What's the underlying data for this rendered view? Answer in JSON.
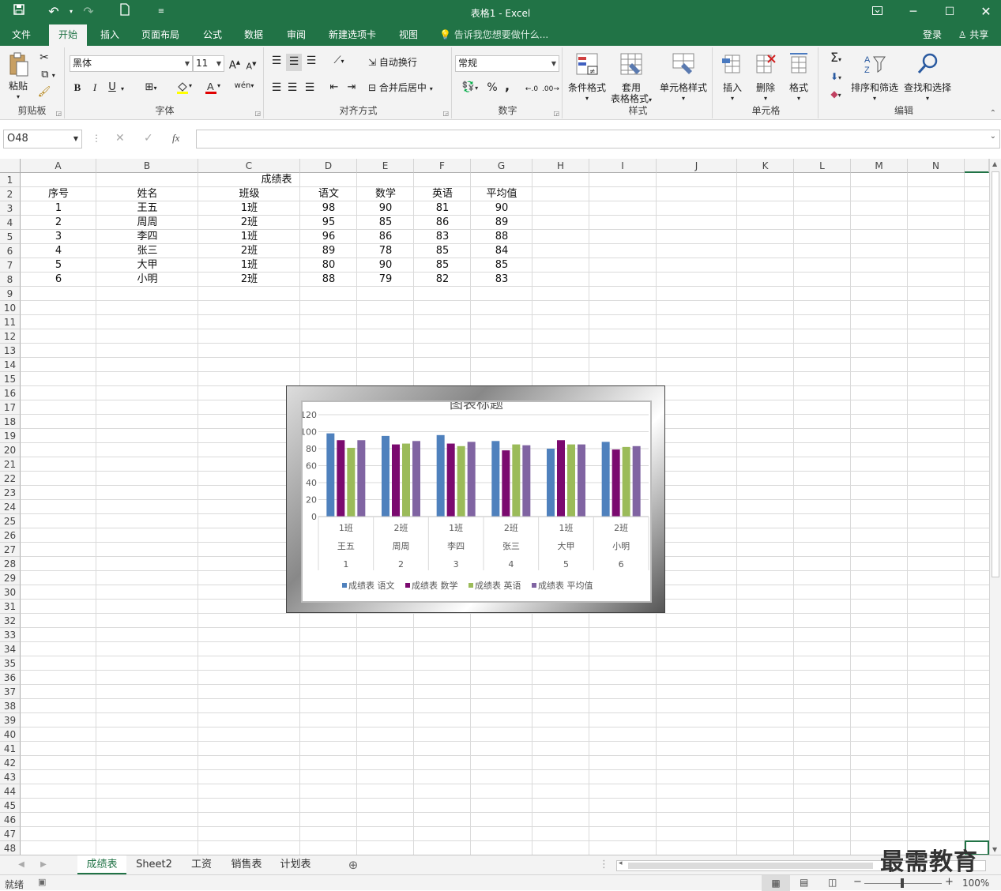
{
  "window": {
    "title": "表格1 - Excel"
  },
  "tabs": [
    "文件",
    "开始",
    "插入",
    "页面布局",
    "公式",
    "数据",
    "审阅",
    "新建选项卡",
    "视图"
  ],
  "active_tab": "开始",
  "tell_me": "告诉我您想要做什么...",
  "account": {
    "login": "登录",
    "share": "共享"
  },
  "ribbon": {
    "clipboard": {
      "label": "剪贴板",
      "paste": "粘贴"
    },
    "font": {
      "label": "字体",
      "name": "黑体",
      "size": "11",
      "bold": "B",
      "italic": "I",
      "underline": "U",
      "phonetic": "wén"
    },
    "alignment": {
      "label": "对齐方式",
      "wrap": "自动换行",
      "merge": "合并后居中"
    },
    "number": {
      "label": "数字",
      "format": "常规",
      "percent": "%",
      "comma": ","
    },
    "styles": {
      "label": "样式",
      "conditional": "条件格式",
      "table1": "套用",
      "table2": "表格格式",
      "cell_styles": "单元格样式"
    },
    "cells": {
      "label": "单元格",
      "insert": "插入",
      "delete": "删除",
      "format": "格式"
    },
    "editing": {
      "label": "编辑",
      "sort": "排序和筛选",
      "find": "查找和选择"
    }
  },
  "formula_bar": {
    "name_box": "O48",
    "fx": "fx",
    "value": ""
  },
  "columns": [
    "A",
    "B",
    "C",
    "D",
    "E",
    "F",
    "G",
    "H",
    "I",
    "J",
    "K",
    "L",
    "M",
    "N"
  ],
  "rows": [
    "1",
    "2",
    "3",
    "4",
    "5",
    "6",
    "7",
    "8",
    "9",
    "10",
    "11",
    "12",
    "13",
    "14",
    "15",
    "16",
    "17",
    "18",
    "19",
    "20",
    "21",
    "22",
    "23",
    "24",
    "25",
    "26",
    "27",
    "28",
    "29",
    "30",
    "31",
    "32",
    "33",
    "34",
    "35",
    "36",
    "37",
    "38",
    "39",
    "40",
    "41",
    "42",
    "43",
    "44",
    "45",
    "46",
    "47",
    "48"
  ],
  "sheet": {
    "title": "成绩表",
    "headers": [
      "序号",
      "姓名",
      "班级",
      "语文",
      "数学",
      "英语",
      "平均值"
    ],
    "data": [
      [
        "1",
        "王五",
        "1班",
        "98",
        "90",
        "81",
        "90"
      ],
      [
        "2",
        "周周",
        "2班",
        "95",
        "85",
        "86",
        "89"
      ],
      [
        "3",
        "李四",
        "1班",
        "96",
        "86",
        "83",
        "88"
      ],
      [
        "4",
        "张三",
        "2班",
        "89",
        "78",
        "85",
        "84"
      ],
      [
        "5",
        "大甲",
        "1班",
        "80",
        "90",
        "85",
        "85"
      ],
      [
        "6",
        "小明",
        "2班",
        "88",
        "79",
        "82",
        "83"
      ]
    ]
  },
  "chart_data": {
    "type": "bar",
    "title": "图表标题",
    "categories": [
      {
        "class": "1班",
        "name": "王五",
        "id": "1"
      },
      {
        "class": "2班",
        "name": "周周",
        "id": "2"
      },
      {
        "class": "1班",
        "name": "李四",
        "id": "3"
      },
      {
        "class": "2班",
        "name": "张三",
        "id": "4"
      },
      {
        "class": "1班",
        "name": "大甲",
        "id": "5"
      },
      {
        "class": "2班",
        "name": "小明",
        "id": "6"
      }
    ],
    "series": [
      {
        "name": "成绩表 语文",
        "color": "#4f81bd",
        "values": [
          98,
          95,
          96,
          89,
          80,
          88
        ]
      },
      {
        "name": "成绩表 数学",
        "color": "#7b0a6f",
        "values": [
          90,
          85,
          86,
          78,
          90,
          79
        ]
      },
      {
        "name": "成绩表 英语",
        "color": "#9bbb59",
        "values": [
          81,
          86,
          83,
          85,
          85,
          82
        ]
      },
      {
        "name": "成绩表 平均值",
        "color": "#8064a2",
        "values": [
          90,
          89,
          88,
          84,
          85,
          83
        ]
      }
    ],
    "ylim": [
      0,
      120
    ],
    "yticks": [
      "0",
      "20",
      "40",
      "60",
      "80",
      "100",
      "120"
    ],
    "grid": true,
    "legend": "bottom"
  },
  "sheet_tabs": [
    "成绩表",
    "Sheet2",
    "工资",
    "销售表",
    "计划表"
  ],
  "active_sheet": "成绩表",
  "status": {
    "ready": "就绪",
    "zoom": "100%"
  },
  "watermark": "最需教育"
}
